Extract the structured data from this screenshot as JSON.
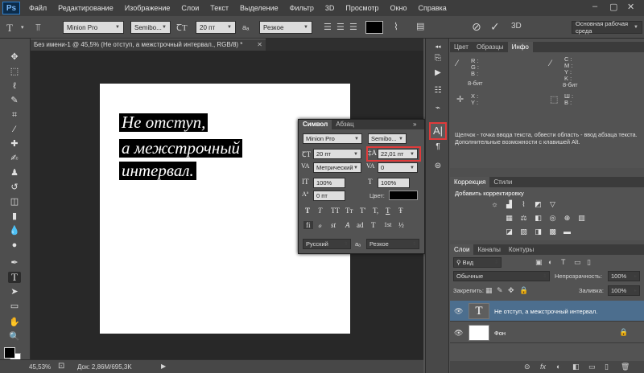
{
  "app": {
    "logo": "Ps"
  },
  "menubar": {
    "items": [
      "Файл",
      "Редактирование",
      "Изображение",
      "Слои",
      "Текст",
      "Выделение",
      "Фильтр",
      "3D",
      "Просмотр",
      "Окно",
      "Справка"
    ]
  },
  "window_controls": {
    "minimize": "–",
    "maximize": "▢",
    "close": "✕"
  },
  "options_bar": {
    "font_family": "Minion Pro",
    "font_style": "Semibo...",
    "font_size": "20 пт",
    "antialias_label": "aₐ",
    "antialias": "Резкое",
    "commit_icon": "✓",
    "cancel_icon": "⊘",
    "workspace": "Основная рабочая среда"
  },
  "document": {
    "tab_title": "Без имени-1 @ 45,5% (Не отступ, а межстрочный интервал., RGB/8) *",
    "text_lines": [
      "Не отступ,",
      "а межстрочный",
      "интервал."
    ]
  },
  "status_bar": {
    "zoom": "45,53%",
    "doc_info": "Док: 2,86M/695,3K"
  },
  "character_panel": {
    "tabs": [
      "Символ",
      "Абзац"
    ],
    "font_family": "Minion Pro",
    "font_style": "Semibo...",
    "font_size": "20 пт",
    "leading": "22,01 пт",
    "kerning": "Метрический",
    "tracking": "0",
    "vertical_scale": "100%",
    "horizontal_scale": "100%",
    "baseline_shift": "0 пт",
    "color_label": "Цвет:",
    "style_buttons": [
      "T",
      "T",
      "TT",
      "Tт",
      "T'",
      "T,",
      "T",
      "Ŧ"
    ],
    "opentype_buttons": [
      "fi",
      "ℴ",
      "st",
      "A",
      "ad",
      "T",
      "1st",
      "½"
    ],
    "language": "Русский",
    "antialias_label": "aₐ",
    "antialias": "Резкое"
  },
  "info_panel": {
    "tabs": [
      "Цвет",
      "Образцы",
      "Инфо"
    ],
    "left_channels": [
      "R :",
      "G :",
      "B :"
    ],
    "right_channels": [
      "C :",
      "M :",
      "Y :",
      "K :"
    ],
    "left_bits": "8-бит",
    "right_bits": "8-бит",
    "xy_labels": [
      "X :",
      "Y :"
    ],
    "wh_labels": [
      "Ш :",
      "В :"
    ],
    "hint": "Щелчок - точка ввода текста, обвести область - ввод абзаца текста. Дополнительные возможности с клавишей Alt."
  },
  "adjustments_panel": {
    "tabs": [
      "Коррекция",
      "Стили"
    ],
    "title": "Добавить корректировку"
  },
  "layers_panel": {
    "tabs": [
      "Слои",
      "Каналы",
      "Контуры"
    ],
    "filter_label": "Вид",
    "blend_mode": "Обычные",
    "opacity_label": "Непрозрачность:",
    "opacity": "100%",
    "lock_label": "Закрепить:",
    "fill_label": "Заливка:",
    "fill": "100%",
    "layers": [
      {
        "name": "Не отступ, а межстрочный интервал.",
        "type_glyph": "T"
      },
      {
        "name": "Фон"
      }
    ],
    "bottom_icons": [
      "⊝",
      "fx",
      "◐",
      "◧",
      "▭",
      "▯",
      "🗑"
    ]
  },
  "colors": {
    "accent_red": "#e03b3b",
    "selected_layer": "#4c6e8e",
    "foreground": "#000000",
    "background": "#ffffff"
  }
}
